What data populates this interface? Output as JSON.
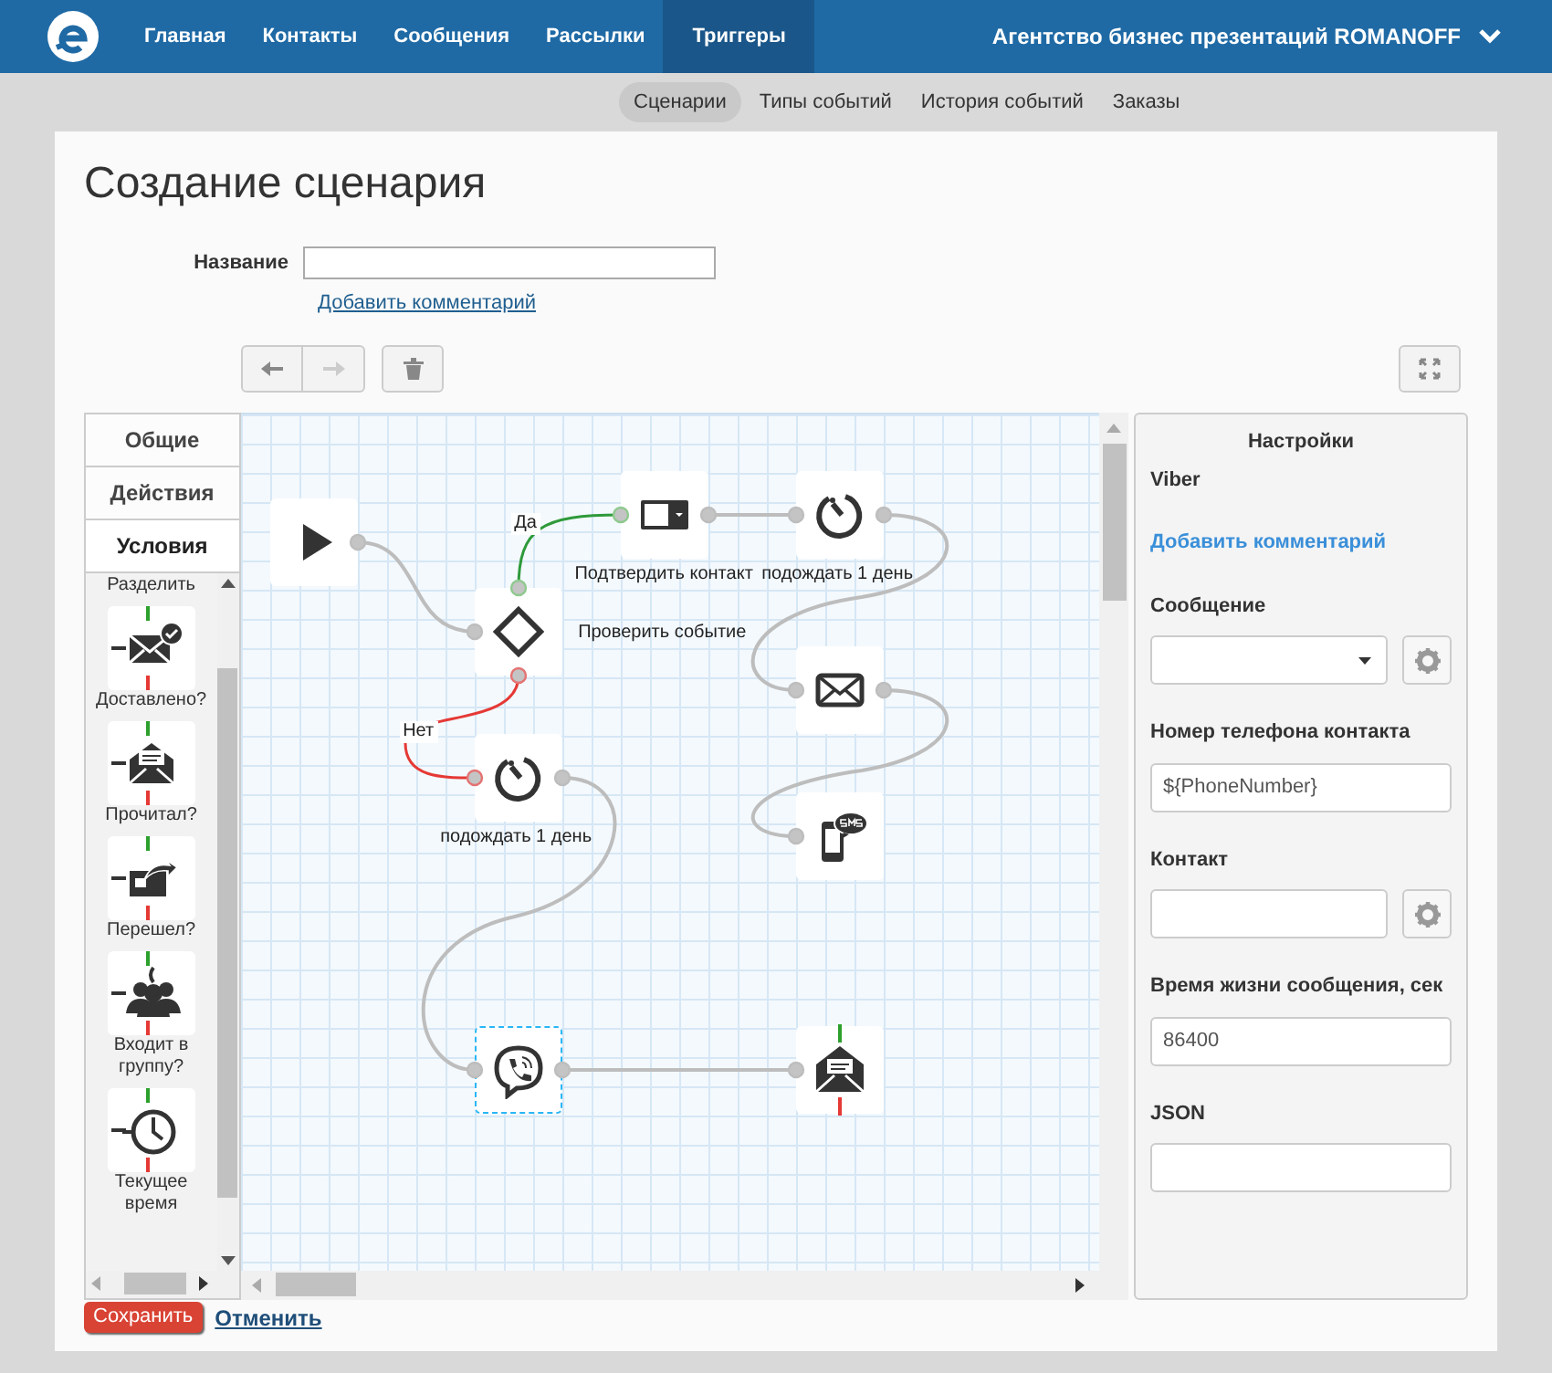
{
  "nav": {
    "items": [
      {
        "label": "Главная",
        "selected": false
      },
      {
        "label": "Контакты",
        "selected": false
      },
      {
        "label": "Сообщения",
        "selected": false
      },
      {
        "label": "Рассылки",
        "selected": false
      },
      {
        "label": "Триггеры",
        "selected": true
      }
    ],
    "account": "Агентство бизнес презентаций ROMANOFF"
  },
  "subnav": [
    {
      "label": "Сценарии",
      "selected": true
    },
    {
      "label": "Типы событий",
      "selected": false
    },
    {
      "label": "История событий",
      "selected": false
    },
    {
      "label": "Заказы",
      "selected": false
    }
  ],
  "page_title": "Создание сценария",
  "form": {
    "name_label": "Название",
    "add_comment": "Добавить комментарий"
  },
  "palette": {
    "tabs": [
      {
        "label": "Общие",
        "selected": false
      },
      {
        "label": "Действия",
        "selected": false
      },
      {
        "label": "Условия",
        "selected": true
      }
    ],
    "items": [
      {
        "kind": "split",
        "label": "Разделить"
      },
      {
        "kind": "delivered",
        "label": "Доставлено?"
      },
      {
        "kind": "read",
        "label": "Прочитал?"
      },
      {
        "kind": "clicked",
        "label": "Перешел?"
      },
      {
        "kind": "group",
        "label": "Входит в группу?"
      },
      {
        "kind": "time",
        "label": "Текущее время"
      }
    ]
  },
  "canvas": {
    "nodes": [
      {
        "kind": "confirm",
        "label": "Подтвердить контакт",
        "selected": false
      },
      {
        "kind": "wait",
        "label": "подождать 1 день",
        "selected": false
      },
      {
        "kind": "start",
        "selected": false
      },
      {
        "kind": "check",
        "label": "Проверить событие",
        "selected": false
      },
      {
        "kind": "email",
        "selected": false
      },
      {
        "kind": "wait",
        "label": "подождать 1 день",
        "selected": false
      },
      {
        "kind": "sms",
        "selected": false
      },
      {
        "kind": "viber",
        "selected": true
      },
      {
        "kind": "read",
        "selected": false
      }
    ],
    "edges": [
      {
        "kind": "yes",
        "label": "Да"
      },
      {
        "kind": "no",
        "label": "Нет"
      }
    ]
  },
  "settings": {
    "title": "Настройки",
    "node_type": "Viber",
    "add_comment": "Добавить комментарий",
    "fields": [
      {
        "kind": "select",
        "label": "Сообщение",
        "gear": true
      },
      {
        "kind": "text",
        "label": "Номер телефона контакта",
        "value": "${PhoneNumber}",
        "gear": false
      },
      {
        "kind": "text",
        "label": "Контакт",
        "gear": true
      },
      {
        "kind": "text",
        "label": "Время жизни сообщения, сек",
        "value": "86400",
        "gear": false
      },
      {
        "kind": "text",
        "label": "JSON",
        "gear": false
      }
    ]
  },
  "actions": {
    "save": "Сохранить",
    "cancel": "Отменить"
  }
}
